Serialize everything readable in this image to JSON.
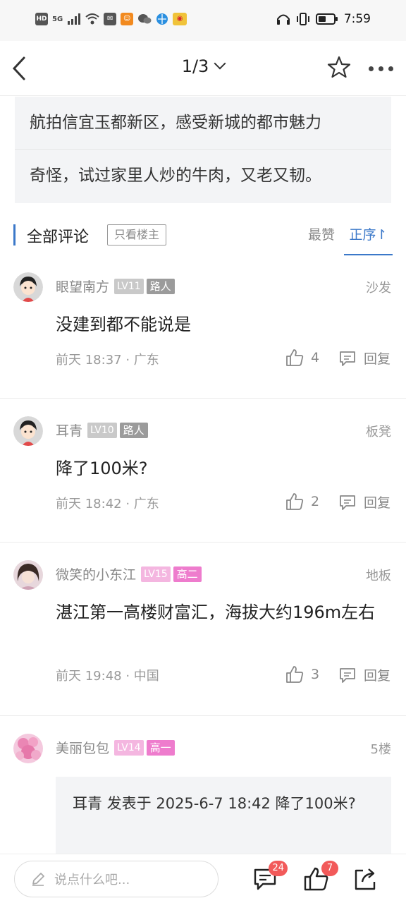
{
  "status_bar": {
    "left_icons": [
      "hd-icon",
      "5g-signal-icon",
      "signal-bars-icon",
      "wifi-icon",
      "mail-app-icon",
      "chat-app-icon",
      "wechat-icon",
      "browser-icon",
      "weibo-icon"
    ],
    "time": "7:59",
    "right_icons": [
      "headphone-icon",
      "vibrate-icon",
      "battery-icon"
    ]
  },
  "nav": {
    "pager": "1/3"
  },
  "quote_lines": [
    "航拍信宜玉都新区，感受新城的都市魅力",
    "奇怪，试过家里人炒的牛肉，又老又韧。"
  ],
  "comments_header": {
    "title": "全部评论",
    "only_op": "只看楼主",
    "sort_hot": "最赞",
    "sort_asc": "正序↾"
  },
  "comments": [
    {
      "name": "眼望南方",
      "level": "LV11",
      "tag": "路人",
      "floor": "沙发",
      "text": "没建到都不能说是",
      "meta": "前天 18:37 · 广东",
      "likes": "4",
      "reply": "回复"
    },
    {
      "name": "耳青",
      "level": "LV10",
      "tag": "路人",
      "floor": "板凳",
      "text": "降了100米?",
      "meta": "前天 18:42 · 广东",
      "likes": "2",
      "reply": "回复"
    },
    {
      "name": "微笑的小东江",
      "level": "LV15",
      "tag": "高二",
      "floor": "地板",
      "text": "湛江第一高楼财富汇，海拔大约196m左右",
      "meta": "前天 19:48 · 中国",
      "likes": "3",
      "reply": "回复"
    },
    {
      "name": "美丽包包",
      "level": "LV14",
      "tag": "高一",
      "floor": "5楼",
      "quote": "耳青 发表于 2025-6-7 18:42 降了100米?"
    }
  ],
  "bottom_bar": {
    "input_placeholder": "说点什么吧...",
    "comment_badge": "24",
    "like_badge": "7"
  },
  "colors": {
    "accent": "#3b78c9",
    "badge": "#f25a5a",
    "tag_pink": "#ee7ccd"
  }
}
